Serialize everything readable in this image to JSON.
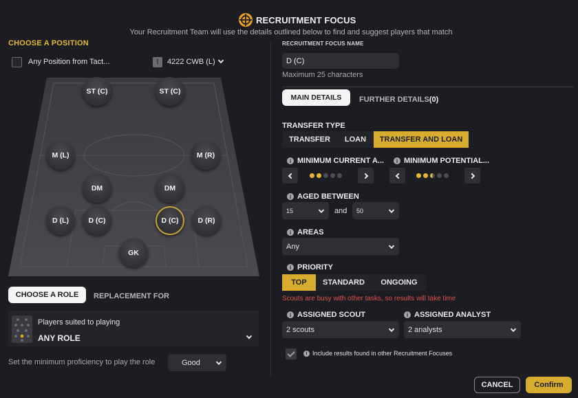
{
  "header": {
    "title": "RECRUITMENT FOCUS",
    "subtitle": "Your Recruitment Team will use the details outlined below to find and suggest players that match"
  },
  "position": {
    "section_title": "CHOOSE A POSITION",
    "any_position_label": "Any Position from Tact...",
    "any_position_checked": false,
    "tactic_label": "4222 CWB (L)",
    "players": [
      {
        "label": "ST (C)",
        "selected": false
      },
      {
        "label": "ST (C)",
        "selected": false
      },
      {
        "label": "M (L)",
        "selected": false
      },
      {
        "label": "M (R)",
        "selected": false
      },
      {
        "label": "DM",
        "selected": false
      },
      {
        "label": "DM",
        "selected": false
      },
      {
        "label": "D (L)",
        "selected": false
      },
      {
        "label": "D (C)",
        "selected": false
      },
      {
        "label": "D (C)",
        "selected": true
      },
      {
        "label": "D (R)",
        "selected": false
      },
      {
        "label": "GK",
        "selected": false
      }
    ]
  },
  "role": {
    "tab_choose": "CHOOSE A ROLE",
    "tab_replacement": "REPLACEMENT FOR",
    "suited_label": "Players suited to playing",
    "role_value": "ANY ROLE",
    "proficiency_label": "Set the minimum proficiency to play the role",
    "proficiency_value": "Good"
  },
  "focus": {
    "name_label": "RECRUITMENT FOCUS NAME",
    "name_value": "D (C)",
    "name_hint": "Maximum 25 characters",
    "tab_main": "MAIN DETAILS",
    "tab_further": "FURTHER DETAILS",
    "tab_further_count": "(0)"
  },
  "transfer_type": {
    "label": "TRANSFER TYPE",
    "options": [
      "TRANSFER",
      "LOAN",
      "TRANSFER AND LOAN"
    ],
    "selected": "TRANSFER AND LOAN"
  },
  "ability": {
    "current_label": "MINIMUM CURRENT A...",
    "current_stars": 2,
    "potential_label": "MINIMUM POTENTIAL...",
    "potential_stars": 2.5,
    "max_stars": 5
  },
  "age": {
    "label": "AGED BETWEEN",
    "min": "15",
    "and_label": "and",
    "max": "50"
  },
  "areas": {
    "label": "AREAS",
    "value": "Any"
  },
  "priority": {
    "label": "PRIORITY",
    "options": [
      "TOP",
      "STANDARD",
      "ONGOING"
    ],
    "selected": "TOP",
    "warning": "Scouts are busy with other tasks, so results will take time"
  },
  "assignment": {
    "scout_label": "ASSIGNED SCOUT",
    "scout_value": "2 scouts",
    "analyst_label": "ASSIGNED ANALYST",
    "analyst_value": "2 analysts",
    "include_label": "Include results found in other Recruitment Focuses",
    "include_checked": true
  },
  "footer": {
    "cancel_label": "CANCEL",
    "confirm_label": "Confirm"
  },
  "colors": {
    "accent": "#d8ad2f",
    "background": "#1c1d22",
    "warning": "#e0504a"
  }
}
